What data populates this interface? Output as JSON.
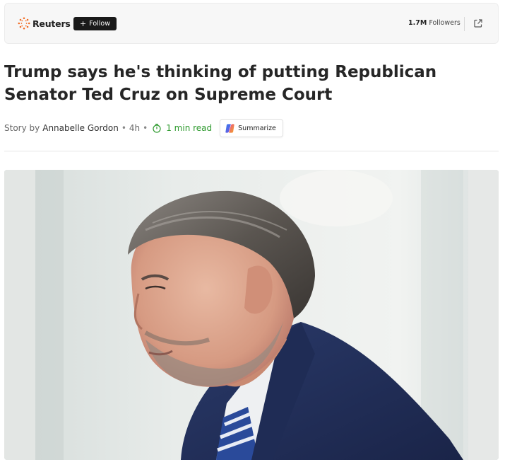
{
  "publisher": {
    "name": "Reuters",
    "logo_icon": "reuters-dot-ring-icon",
    "brand_color": "#f26a21",
    "follow_label": "Follow",
    "followers_count": "1.7M",
    "followers_label": "Followers",
    "share_icon": "open-external-icon"
  },
  "article": {
    "headline": "Trump says he's thinking of putting Republican Senator Ted Cruz on Supreme Court",
    "byline": {
      "prefix": "Story by",
      "author": "Annabelle Gordon",
      "separator": "•",
      "age": "4h",
      "read_time": "1 min read",
      "read_time_color": "#2e9a2e",
      "timer_icon": "stopwatch-icon"
    },
    "summarize_label": "Summarize",
    "summarize_icon": "copilot-icon"
  },
  "hero_image": {
    "subject": "photo-of-senator"
  }
}
